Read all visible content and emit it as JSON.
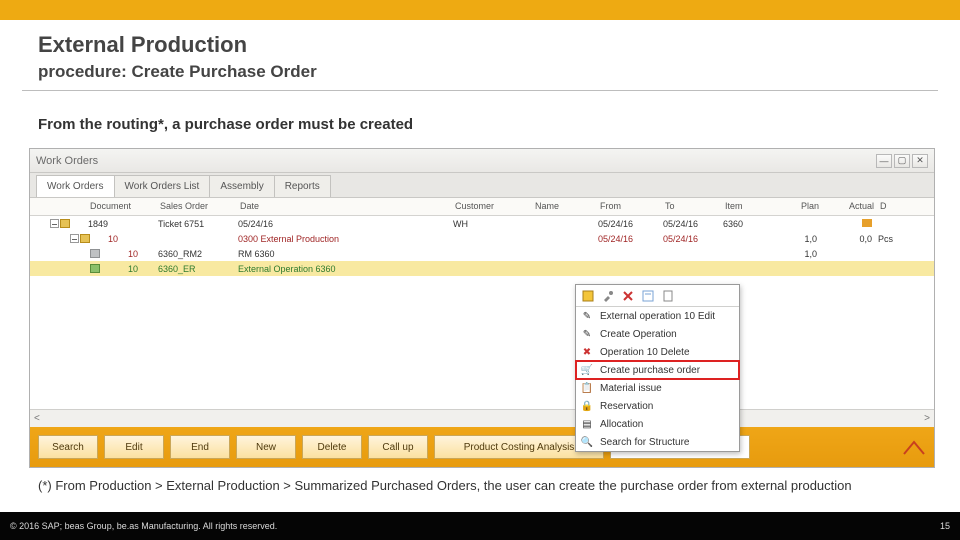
{
  "header": {
    "title": "External Production",
    "subtitle": "procedure: Create Purchase Order"
  },
  "lead": "From the routing*, a purchase order must be created",
  "window": {
    "title": "Work Orders"
  },
  "tabs": [
    {
      "label": "Work Orders",
      "active": true
    },
    {
      "label": "Work Orders List",
      "active": false
    },
    {
      "label": "Assembly",
      "active": false
    },
    {
      "label": "Reports",
      "active": false
    }
  ],
  "columns": {
    "doc": "Document",
    "so": "Sales Order",
    "date": "Date",
    "cust": "Customer",
    "name": "Name",
    "from": "From",
    "to": "To",
    "item": "Item",
    "plan": "Plan",
    "actual": "Actual",
    "end": "D"
  },
  "rows": [
    {
      "doc": "1849",
      "so": "Ticket 6751",
      "date": "05/24/16",
      "cust": "WH",
      "name": "",
      "from": "05/24/16",
      "to": "05/24/16",
      "item": "6360",
      "plan": "",
      "actual": "",
      "unit": ""
    },
    {
      "doc": "10",
      "so": "",
      "date": "0300 External Production",
      "cust": "",
      "name": "",
      "from": "05/24/16",
      "to": "05/24/16",
      "item": "",
      "plan": "1,0",
      "actual": "0,0",
      "unit": "Pcs"
    },
    {
      "doc": "10",
      "so": "6360_RM2",
      "date": "RM 6360",
      "cust": "",
      "name": "",
      "from": "",
      "to": "",
      "item": "",
      "plan": "1,0",
      "actual": "",
      "unit": ""
    },
    {
      "doc": "10",
      "so": "6360_ER",
      "date": "External Operation 6360",
      "cust": "",
      "name": "",
      "from": "",
      "to": "",
      "item": "",
      "plan": "",
      "actual": "",
      "unit": ""
    }
  ],
  "context_menu": {
    "items": [
      {
        "label": "External operation 10 Edit",
        "icon": "✎"
      },
      {
        "label": "Create Operation",
        "icon": "✎"
      },
      {
        "label": "Operation 10 Delete",
        "icon": "✖"
      },
      {
        "label": "Create purchase order",
        "icon": "🛒",
        "highlight": true
      },
      {
        "label": "Material issue",
        "icon": "📋"
      },
      {
        "label": "Reservation",
        "icon": "🔒"
      },
      {
        "label": "Allocation",
        "icon": "▤"
      },
      {
        "label": "Search for Structure",
        "icon": "🔍"
      }
    ]
  },
  "buttons": {
    "search": "Search",
    "edit": "Edit",
    "end": "End",
    "new": "New",
    "delete": "Delete",
    "callup": "Call up",
    "analysis": "Product Costing Analysis",
    "id": "1849"
  },
  "note": "(*) From Production > External Production > Summarized Purchased Orders, the user can create the purchase order from external production",
  "footer": {
    "copyright": "© 2016 SAP; beas Group, be.as Manufacturing. All rights reserved.",
    "page": "15"
  }
}
